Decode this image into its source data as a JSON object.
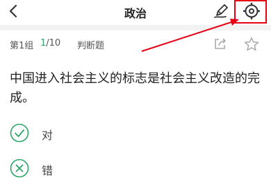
{
  "header": {
    "title": "政治",
    "back_icon": "chevron-left-icon",
    "edit_icon": "pen-icon",
    "settings_icon": "settings-gear-icon"
  },
  "subheader": {
    "group": "第1组",
    "progress_current": "1",
    "progress_total": "/10",
    "question_type": "判断题",
    "share_icon": "share-icon",
    "star_icon": "star-icon"
  },
  "question": {
    "text": "中国进入社会主义的标志是社会主义改造的完成。"
  },
  "options": [
    {
      "label": "对",
      "icon": "check-circle-icon"
    },
    {
      "label": "错",
      "icon": "x-circle-icon"
    }
  ],
  "colors": {
    "accent": "#2aa666",
    "annotation": "#e60012"
  }
}
